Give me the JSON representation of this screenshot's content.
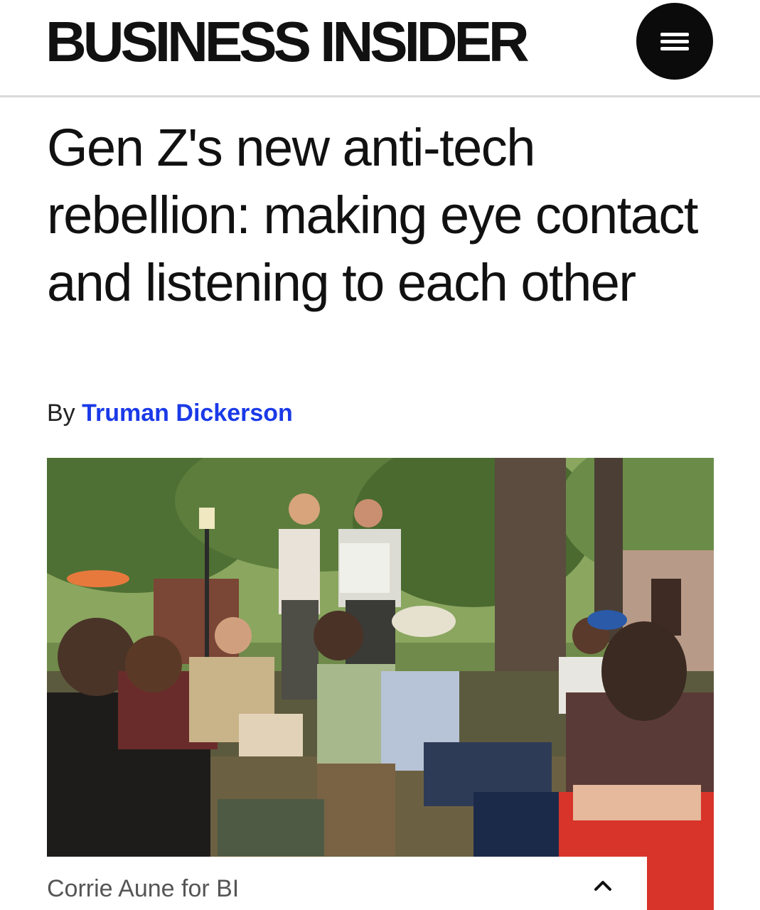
{
  "header": {
    "logo_text": "BUSINESS INSIDER",
    "menu_icon": "hamburger-menu-icon"
  },
  "article": {
    "headline": "Gen Z's new anti-tech rebellion: making eye contact and listening to each other",
    "byline_prefix": "By",
    "author": "Truman Dickerson",
    "author_color": "#1a3ae8"
  },
  "image": {
    "caption": "Corrie Aune for BI",
    "caption_toggle_icon": "chevron-up-icon"
  }
}
